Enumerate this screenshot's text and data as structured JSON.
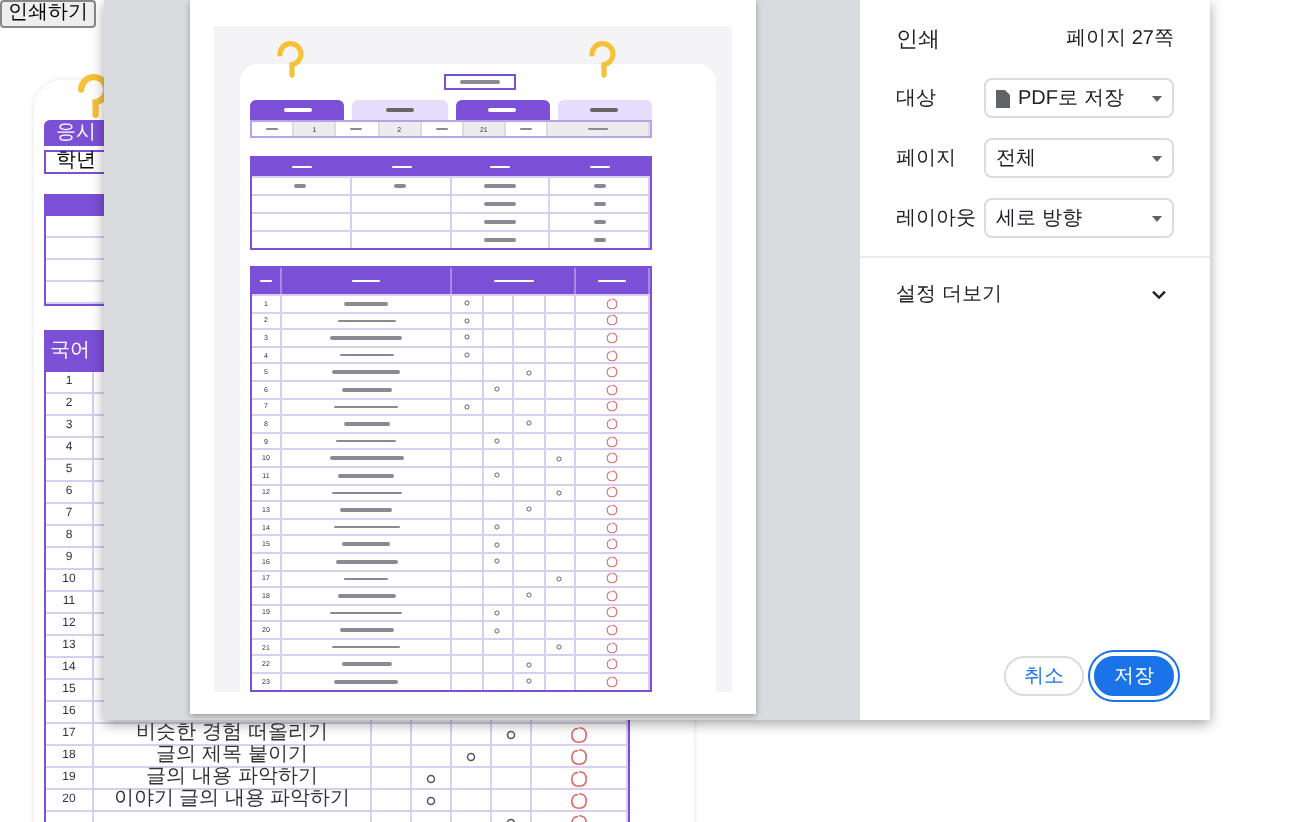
{
  "print_button": {
    "label": "인쇄하기"
  },
  "background_doc": {
    "date_tab": "응시",
    "grade_label": "학년",
    "table_header": "국어",
    "rows": [
      {
        "number": "1"
      },
      {
        "number": "2"
      },
      {
        "number": "3"
      },
      {
        "number": "4"
      },
      {
        "number": "5"
      },
      {
        "number": "6"
      },
      {
        "number": "7"
      },
      {
        "number": "8"
      },
      {
        "number": "9"
      },
      {
        "number": "10"
      },
      {
        "number": "11"
      },
      {
        "number": "12"
      },
      {
        "number": "13"
      },
      {
        "number": "14"
      },
      {
        "number": "15"
      },
      {
        "number": "16"
      },
      {
        "number": "17",
        "item": "비슷한 경험 떠올리기",
        "checks": [
          false,
          false,
          false,
          true
        ]
      },
      {
        "number": "18",
        "item": "글의 제목 붙이기",
        "checks": [
          false,
          false,
          true,
          false
        ]
      },
      {
        "number": "19",
        "item": "글의 내용 파악하기",
        "checks": [
          false,
          true,
          false,
          false
        ]
      },
      {
        "number": "20",
        "item": "이야기 글의 내용 파악하기",
        "checks": [
          false,
          true,
          false,
          false
        ]
      },
      {
        "checks": [
          false,
          false,
          false,
          true
        ]
      }
    ]
  },
  "preview": {
    "tabs": [
      {
        "kind": "dark"
      },
      {
        "kind": "light"
      },
      {
        "kind": "dark"
      },
      {
        "kind": "light"
      }
    ],
    "info": [
      {
        "kind": "label"
      },
      {
        "kind": "value",
        "text": "1"
      },
      {
        "kind": "label"
      },
      {
        "kind": "value",
        "text": "2"
      },
      {
        "kind": "label"
      },
      {
        "kind": "value",
        "text": "21"
      },
      {
        "kind": "label"
      },
      {
        "kind": "wide"
      }
    ],
    "rows": [
      {
        "number": "1",
        "checks": [
          true,
          false,
          false,
          false
        ]
      },
      {
        "number": "2",
        "checks": [
          true,
          false,
          false,
          false
        ]
      },
      {
        "number": "3",
        "checks": [
          true,
          false,
          false,
          false
        ]
      },
      {
        "number": "4",
        "checks": [
          true,
          false,
          false,
          false
        ]
      },
      {
        "number": "5",
        "checks": [
          false,
          false,
          true,
          false
        ]
      },
      {
        "number": "6",
        "checks": [
          false,
          true,
          false,
          false
        ]
      },
      {
        "number": "7",
        "checks": [
          true,
          false,
          false,
          false
        ]
      },
      {
        "number": "8",
        "checks": [
          false,
          false,
          true,
          false
        ]
      },
      {
        "number": "9",
        "checks": [
          false,
          true,
          false,
          false
        ]
      },
      {
        "number": "10",
        "checks": [
          false,
          false,
          false,
          true
        ]
      },
      {
        "number": "11",
        "checks": [
          false,
          true,
          false,
          false
        ]
      },
      {
        "number": "12",
        "checks": [
          false,
          false,
          false,
          true
        ]
      },
      {
        "number": "13",
        "checks": [
          false,
          false,
          true,
          false
        ]
      },
      {
        "number": "14",
        "checks": [
          false,
          true,
          false,
          false
        ]
      },
      {
        "number": "15",
        "checks": [
          false,
          true,
          false,
          false
        ]
      },
      {
        "number": "16",
        "checks": [
          false,
          true,
          false,
          false
        ]
      },
      {
        "number": "17",
        "checks": [
          false,
          false,
          false,
          true
        ]
      },
      {
        "number": "18",
        "checks": [
          false,
          false,
          true,
          false
        ]
      },
      {
        "number": "19",
        "checks": [
          false,
          true,
          false,
          false
        ]
      },
      {
        "number": "20",
        "checks": [
          false,
          true,
          false,
          false
        ]
      },
      {
        "number": "21",
        "checks": [
          false,
          false,
          false,
          true
        ]
      },
      {
        "number": "22",
        "checks": [
          false,
          false,
          true,
          false
        ]
      },
      {
        "number": "23",
        "checks": [
          false,
          false,
          true,
          false
        ]
      }
    ]
  },
  "panel": {
    "title": "인쇄",
    "page_count": "페이지 27쪽",
    "settings": [
      {
        "label": "대상",
        "value": "PDF로 저장",
        "kind": "file"
      },
      {
        "label": "페이지",
        "value": "전체",
        "kind": "plain"
      },
      {
        "label": "레이아웃",
        "value": "세로 방향",
        "kind": "plain"
      }
    ],
    "more": {
      "label": "설정 더보기",
      "expanded": false
    },
    "buttons": [
      {
        "label": "취소",
        "kind": "secondary"
      },
      {
        "label": "저장",
        "kind": "primary"
      }
    ]
  }
}
